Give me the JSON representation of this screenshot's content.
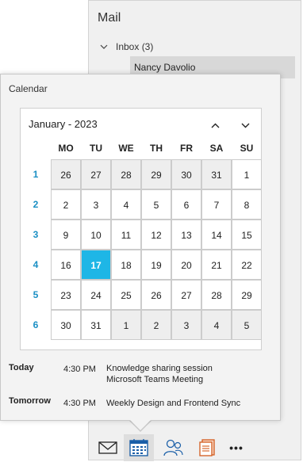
{
  "mail": {
    "title": "Mail",
    "inbox_label": "Inbox (3)",
    "selected_item": "Nancy Davolio"
  },
  "calendar_popup": {
    "title": "Calendar",
    "month_label": "January - 2023",
    "day_headers": [
      "MO",
      "TU",
      "WE",
      "TH",
      "FR",
      "SA",
      "SU"
    ],
    "weeks": [
      {
        "num": "1",
        "days": [
          "26",
          "27",
          "28",
          "29",
          "30",
          "31",
          "1"
        ]
      },
      {
        "num": "2",
        "days": [
          "2",
          "3",
          "4",
          "5",
          "6",
          "7",
          "8"
        ]
      },
      {
        "num": "3",
        "days": [
          "9",
          "10",
          "11",
          "12",
          "13",
          "14",
          "15"
        ]
      },
      {
        "num": "4",
        "days": [
          "16",
          "17",
          "18",
          "19",
          "20",
          "21",
          "22"
        ]
      },
      {
        "num": "5",
        "days": [
          "23",
          "24",
          "25",
          "26",
          "27",
          "28",
          "29"
        ]
      },
      {
        "num": "6",
        "days": [
          "30",
          "31",
          "1",
          "2",
          "3",
          "4",
          "5"
        ]
      }
    ],
    "today_date": "17",
    "colors": {
      "today": "#1eb6e6",
      "week_number": "#1a8fc4",
      "other_month_bg": "#eeeeee"
    }
  },
  "agenda": [
    {
      "day": "Today",
      "time": "4:30 PM",
      "subject_line1": "Knowledge sharing session",
      "subject_line2": "Microsoft Teams Meeting"
    },
    {
      "day": "Tomorrow",
      "time": "4:30 PM",
      "subject_line1": "Weekly Design and Frontend Sync",
      "subject_line2": ""
    }
  ],
  "bottom_nav": {
    "items": [
      "mail-icon",
      "calendar-icon",
      "people-icon",
      "tasks-icon",
      "more-icon"
    ],
    "active": "calendar-icon",
    "more_label": "•••"
  }
}
